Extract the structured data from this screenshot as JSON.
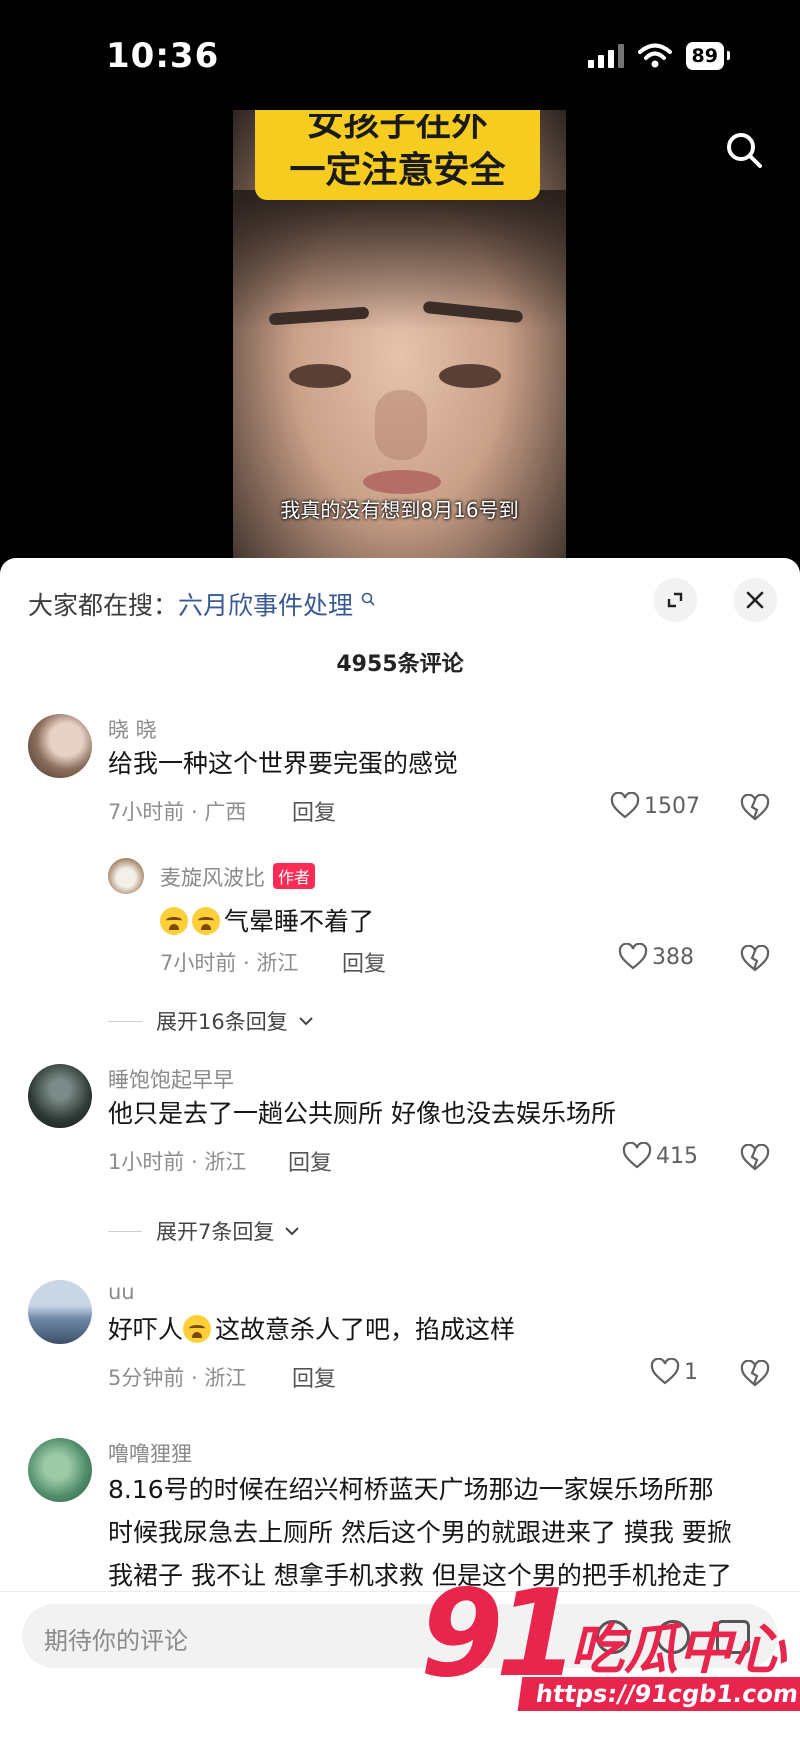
{
  "status_bar": {
    "time": "10:36",
    "battery": "89"
  },
  "video": {
    "banner_line1": "女孩子在外",
    "banner_line2": "一定注意安全",
    "subtitle": "我真的没有想到8月16号到"
  },
  "sheet": {
    "hot_search_prefix": "大家都在搜：",
    "hot_search_link": "六月欣事件处理",
    "comment_count": "4955条评论"
  },
  "comments": [
    {
      "user": "晓 晓",
      "text": "给我一种这个世界要完蛋的感觉",
      "meta": "7小时前 · 广西",
      "reply_label": "回复",
      "likes": "1507"
    },
    {
      "user": "麦旋风波比",
      "badge": "作者",
      "text": "气晕睡不着了",
      "meta": "7小时前 · 浙江",
      "reply_label": "回复",
      "likes": "388",
      "expand": "展开16条回复"
    },
    {
      "user": "睡饱饱起早早",
      "text": "他只是去了一趟公共厕所 好像也没去娱乐场所",
      "meta": "1小时前 · 浙江",
      "reply_label": "回复",
      "likes": "415",
      "expand": "展开7条回复"
    },
    {
      "user": "uu",
      "text_before": "好吓人",
      "text_after": "这故意杀人了吧，掐成这样",
      "meta": "5分钟前 · 浙江",
      "reply_label": "回复",
      "likes": "1"
    },
    {
      "user": "噜噜狸狸",
      "text_line1": "8.16号的时候在绍兴柯桥蓝天广场那边一家娱乐场所那",
      "text_line2": "时候我尿急去上厕所 然后这个男的就跟进来了 摸我 要掀",
      "text_line3": "我裙子 我不让 想拿手机求救 但是这个男的把手机抢走了"
    }
  ],
  "input": {
    "placeholder": "期待你的评论"
  },
  "watermark": {
    "number": "91",
    "text": "吃瓜中心",
    "url": "https://91cgb1.com"
  },
  "colors": {
    "accent": "#fe2c55",
    "link": "#3a5a93",
    "watermark": "#e8254c",
    "banner": "#f6cc20"
  }
}
